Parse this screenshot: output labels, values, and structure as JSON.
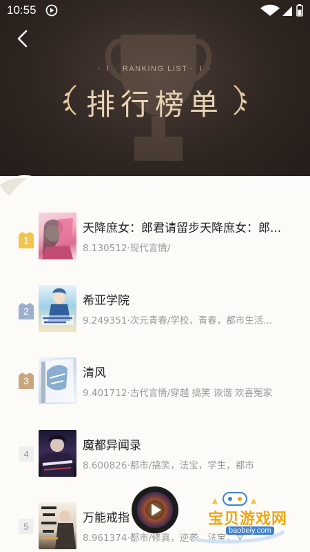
{
  "status_bar": {
    "time": "10:55"
  },
  "header": {
    "subtitle": "RANKING LIST",
    "title": "排行榜单"
  },
  "books": [
    {
      "rank": "1",
      "title": "天降庶女：郎君请留步天降庶女：郎...",
      "meta": "8.130512·现代言情/"
    },
    {
      "rank": "2",
      "title": "希亚学院",
      "meta": "9.249351·次元青春/学校，青春，都市生活..."
    },
    {
      "rank": "3",
      "title": "清风",
      "meta": "9.401712·古代言情/穿越 搞笑 诙谐 欢喜冤家"
    },
    {
      "rank": "4",
      "title": "魔都异闻录",
      "meta": "8.600826·都市/搞笑，法宝，学生，都市"
    },
    {
      "rank": "5",
      "title": "万能戒指",
      "meta": "8.961374·都市/修真，逆袭，法宝，文..."
    }
  ],
  "badge_colors": {
    "gold": "#f3c64b",
    "silver": "#9cb0cc",
    "bronze": "#c9a57d"
  },
  "watermark": {
    "text": "宝贝游戏网",
    "url": "baobeiy.com"
  }
}
